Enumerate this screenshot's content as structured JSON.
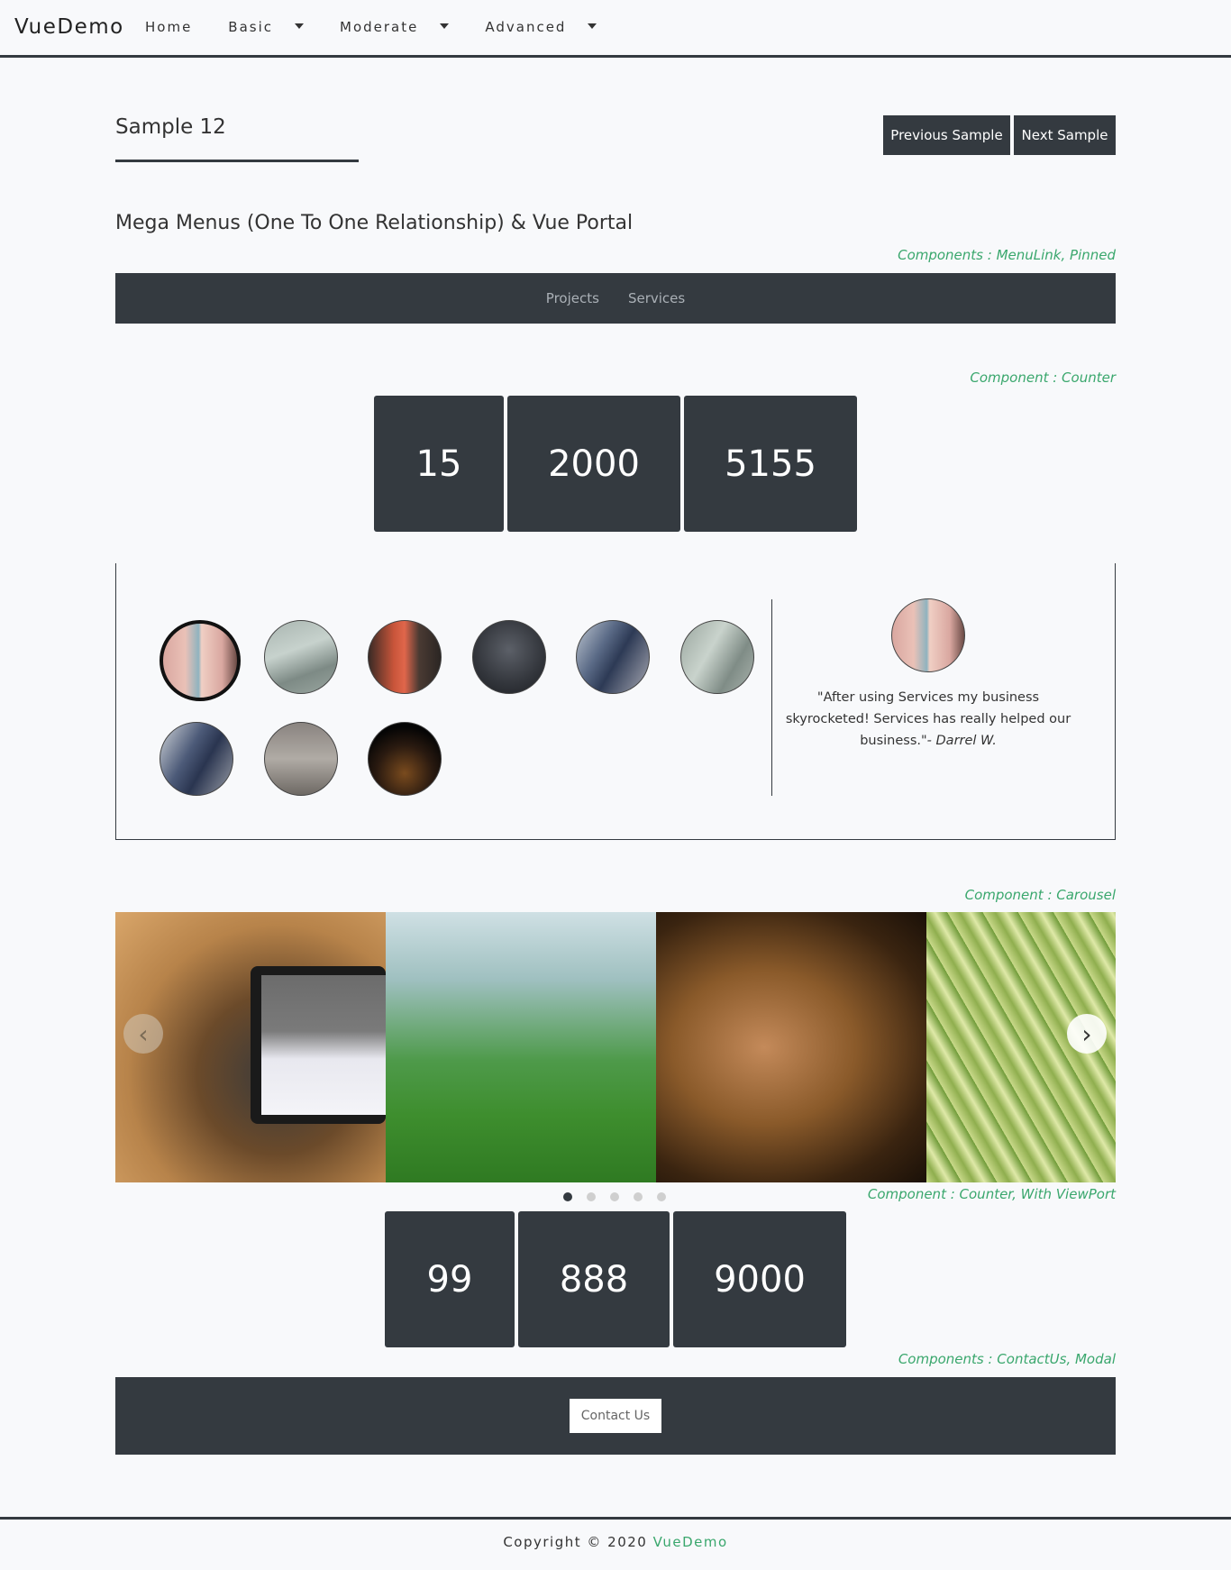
{
  "nav": {
    "brand": "VueDemo",
    "items": [
      "Home",
      "Basic",
      "Moderate",
      "Advanced"
    ]
  },
  "sample": {
    "title": "Sample 12",
    "prev_label": "Previous Sample",
    "next_label": "Next Sample"
  },
  "section_title": "Mega Menus (One To One Relationship) & Vue Portal",
  "labels": {
    "menulink": "Components : MenuLink, Pinned",
    "counter": "Component : Counter",
    "carousel": "Component : Carousel",
    "counter_viewport": "Component : Counter, With ViewPort",
    "contactus": "Components : ContactUs, Modal"
  },
  "megamenu": {
    "items": [
      "Projects",
      "Services"
    ]
  },
  "counters_top": [
    "15",
    "2000",
    "5155"
  ],
  "testimonial": {
    "quote": "\"After using Services my business skyrocketed! Services has really helped our business.\"",
    "author": "- Darrel W."
  },
  "counters_bottom": [
    "99",
    "888",
    "9000"
  ],
  "contact": {
    "button_label": "Contact Us"
  },
  "footer": {
    "text": "Copyright © 2020",
    "brand": "VueDemo"
  },
  "colors": {
    "dark": "#343a40",
    "accent": "#3aa76d",
    "background": "#f8f9fb"
  },
  "icons": {
    "carousel_prev": "chevron-left-icon",
    "carousel_next": "chevron-right-icon",
    "dropdown": "caret-down-icon"
  },
  "carousel": {
    "slide_count": 5,
    "active_index": 0
  }
}
